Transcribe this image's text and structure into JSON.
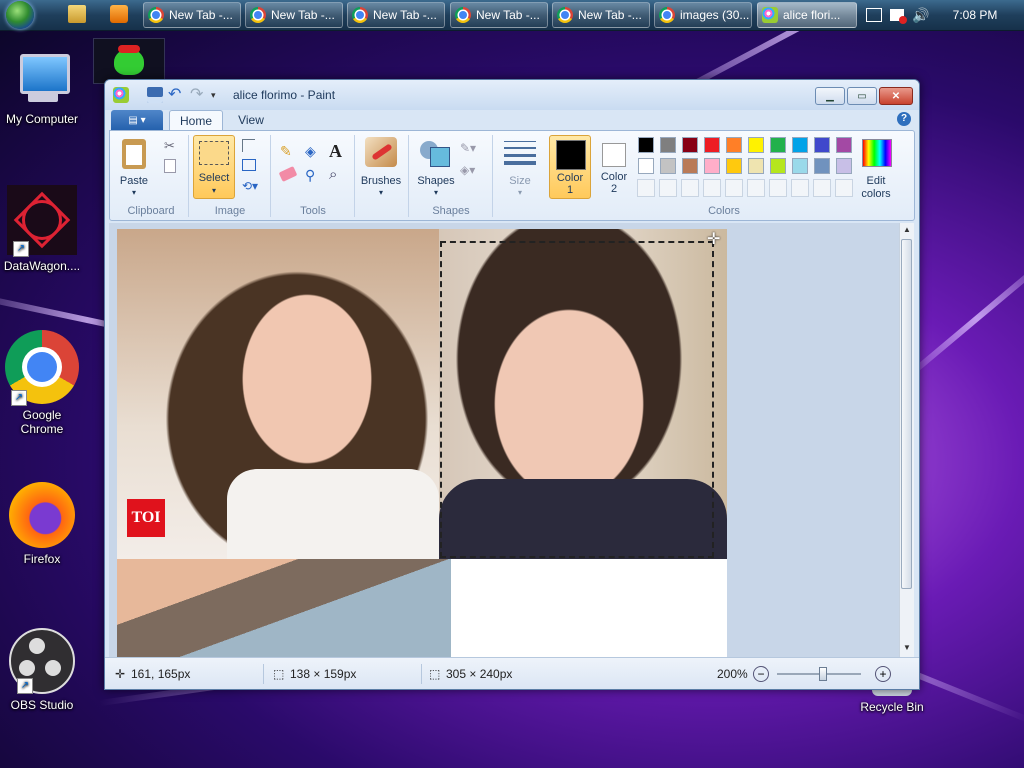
{
  "taskbar": {
    "tabs": [
      {
        "label": "New Tab -...",
        "icon": "chrome-icon"
      },
      {
        "label": "New Tab -...",
        "icon": "chrome-icon"
      },
      {
        "label": "New Tab -...",
        "icon": "chrome-icon"
      },
      {
        "label": "New Tab -...",
        "icon": "chrome-icon"
      },
      {
        "label": "New Tab -...",
        "icon": "chrome-icon"
      },
      {
        "label": "images (30...",
        "icon": "chrome-icon"
      },
      {
        "label": "alice flori...",
        "icon": "paint-icon"
      }
    ],
    "clock": "7:08 PM"
  },
  "desktop": {
    "icons": [
      {
        "label": "My Computer",
        "icon": "computer-icon"
      },
      {
        "label": "DataWagon....",
        "icon": "datawagon-icon"
      },
      {
        "label": "Google Chrome",
        "icon": "chrome-icon"
      },
      {
        "label": "Firefox",
        "icon": "firefox-icon"
      },
      {
        "label": "OBS Studio",
        "icon": "obs-icon"
      },
      {
        "label": "Recycle Bin",
        "icon": "recycle-bin-icon"
      }
    ]
  },
  "paint": {
    "title": "alice florimo - Paint",
    "tabs": {
      "home": "Home",
      "view": "View"
    },
    "ribbon": {
      "paste": "Paste",
      "select": "Select",
      "brushes": "Brushes",
      "shapes": "Shapes",
      "size": "Size",
      "color1_a": "Color",
      "color1_b": "1",
      "color2_a": "Color",
      "color2_b": "2",
      "edit_colors_a": "Edit",
      "edit_colors_b": "colors",
      "groups": {
        "clipboard": "Clipboard",
        "image": "Image",
        "tools": "Tools",
        "shapes": "Shapes",
        "colors": "Colors"
      }
    },
    "palette_row1": [
      "#000000",
      "#7f7f7f",
      "#880015",
      "#ed1c24",
      "#ff7f27",
      "#fff200",
      "#22b14c",
      "#00a2e8",
      "#3f48cc",
      "#a349a4"
    ],
    "palette_row2": [
      "#ffffff",
      "#c3c3c3",
      "#b97a57",
      "#ffaec9",
      "#ffc90e",
      "#efe4b0",
      "#b5e61d",
      "#99d9ea",
      "#7092be",
      "#c8bfe7"
    ],
    "color1": "#000000",
    "color2": "#ffffff",
    "canvas": {
      "logo_text": "TOI"
    },
    "status": {
      "cursor_pos": "161, 165px",
      "selection_size": "138 × 159px",
      "image_size": "305 × 240px",
      "zoom": "200%"
    }
  }
}
